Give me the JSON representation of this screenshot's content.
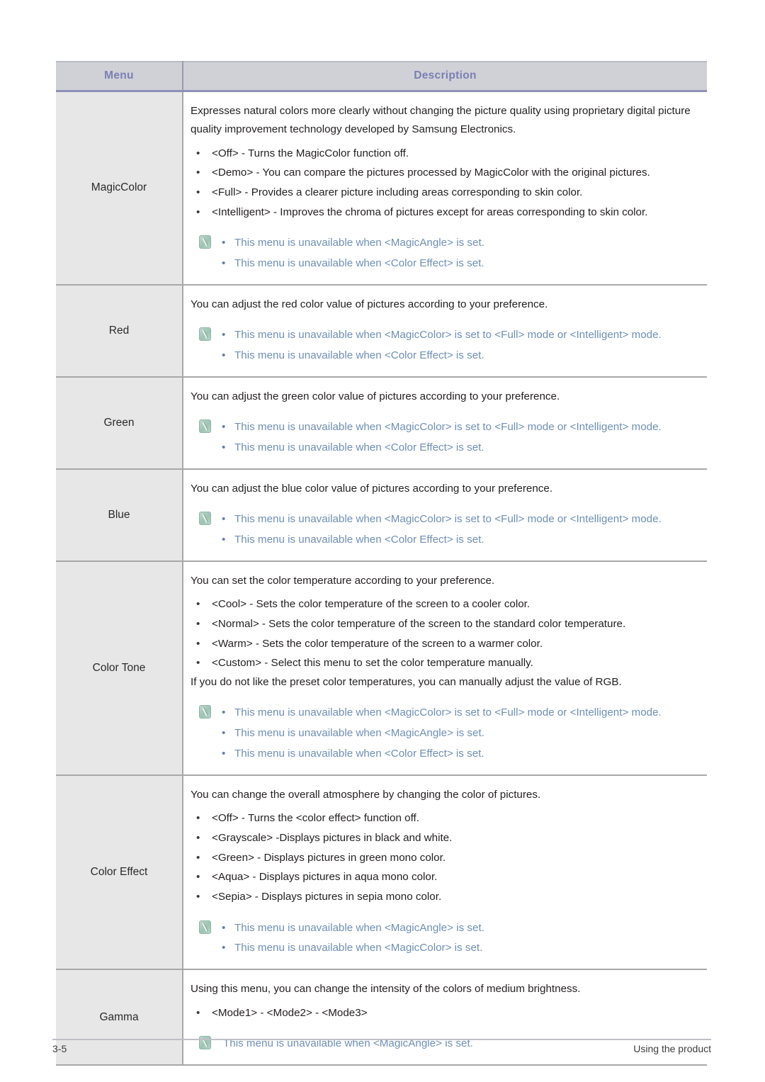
{
  "table": {
    "headers": {
      "menu": "Menu",
      "description": "Description"
    },
    "rows": [
      {
        "menu": "MagicColor",
        "intro": "Expresses natural colors more clearly without changing the picture quality using proprietary digital picture quality improvement technology developed by Samsung Electronics.",
        "options": [
          "<Off> - Turns the MagicColor function off.",
          "<Demo> - You can compare the pictures processed by MagicColor with the original pictures.",
          "<Full> - Provides a clearer picture including areas corresponding to skin color.",
          "<Intelligent> - Improves the chroma of pictures except for areas corresponding to skin color."
        ],
        "after": "",
        "notes": [
          "This menu is unavailable when <MagicAngle> is set.",
          "This menu is unavailable when <Color Effect> is set."
        ],
        "notes_bulleted": true
      },
      {
        "menu": "Red",
        "intro": "You can adjust the red color value of pictures according to your preference.",
        "options": [],
        "after": "",
        "notes": [
          "This menu is unavailable when <MagicColor> is set to <Full> mode or <Intelligent> mode.",
          "This menu is unavailable when <Color Effect> is set."
        ],
        "notes_bulleted": true
      },
      {
        "menu": "Green",
        "intro": "You can adjust the green color value of pictures according to your preference.",
        "options": [],
        "after": "",
        "notes": [
          "This menu is unavailable when <MagicColor> is set to <Full> mode or <Intelligent> mode.",
          "This menu is unavailable when <Color Effect> is set."
        ],
        "notes_bulleted": true
      },
      {
        "menu": "Blue",
        "intro": "You can adjust the blue color value of pictures according to your preference.",
        "options": [],
        "after": "",
        "notes": [
          "This menu is unavailable when <MagicColor> is set to <Full> mode or <Intelligent> mode.",
          "This menu is unavailable when <Color Effect> is set."
        ],
        "notes_bulleted": true
      },
      {
        "menu": "Color Tone",
        "intro": "You can set the color temperature according to your preference.",
        "options": [
          "<Cool> - Sets the color temperature of the screen to a cooler color.",
          "<Normal> - Sets the color temperature of the screen to the standard color temperature.",
          "<Warm> - Sets the color temperature of the screen to a warmer color.",
          "<Custom> - Select this menu to set the color temperature manually."
        ],
        "after": "If you do not like the preset color temperatures, you can manually adjust the value of RGB.",
        "notes": [
          "This menu is unavailable when <MagicColor> is set to <Full> mode or <Intelligent> mode.",
          "This menu is unavailable when <MagicAngle> is set.",
          "This menu is unavailable when <Color Effect> is set."
        ],
        "notes_bulleted": true
      },
      {
        "menu": "Color Effect",
        "intro": "You can change the overall atmosphere by changing the color of pictures.",
        "options": [
          "<Off> - Turns the <color effect> function off.",
          "<Grayscale> -Displays pictures in black and white.",
          "<Green> - Displays pictures in green mono color.",
          "<Aqua> - Displays pictures in aqua mono color.",
          "<Sepia> - Displays pictures in sepia mono color."
        ],
        "after": "",
        "notes": [
          "This menu is unavailable when <MagicAngle> is set.",
          "This menu is unavailable when <MagicColor> is set."
        ],
        "notes_bulleted": true
      },
      {
        "menu": "Gamma",
        "intro": "Using this menu, you can change the intensity of the colors of medium brightness.",
        "options": [
          "<Mode1> - <Mode2> - <Mode3>"
        ],
        "after": "",
        "notes": [
          "This menu is unavailable when <MagicAngle> is set."
        ],
        "notes_bulleted": false
      }
    ]
  },
  "bullet_glyph": "•",
  "footer": {
    "page_number": "3-5",
    "section": "Using the product"
  }
}
